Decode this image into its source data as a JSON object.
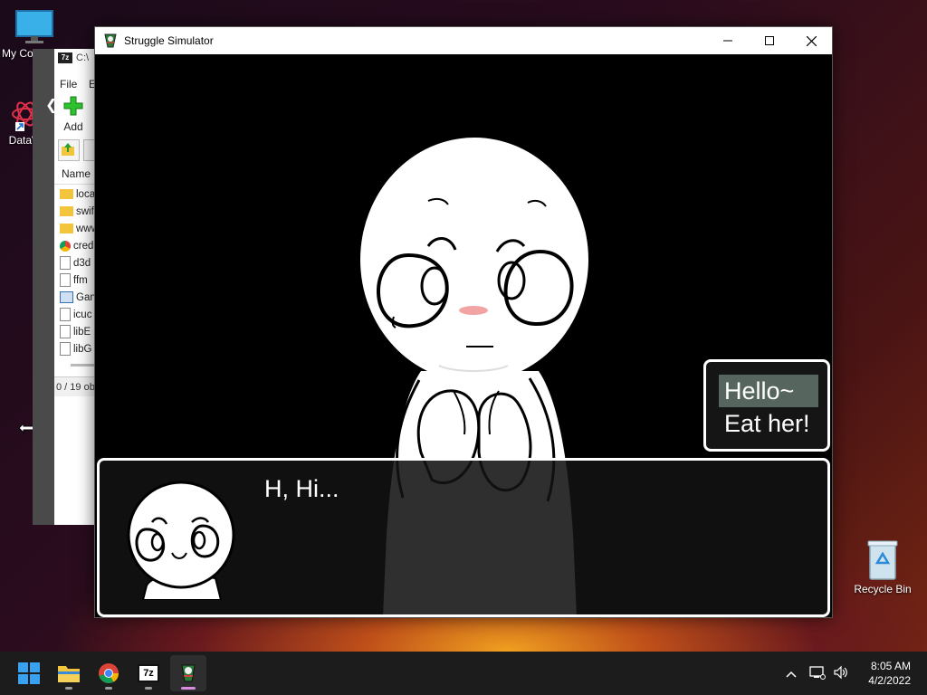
{
  "desktop": {
    "icons": [
      {
        "label": "My Co",
        "icon": "monitor-icon"
      },
      {
        "label": "DataW",
        "icon": "datawrangler-icon"
      },
      {
        "label": "Recycle Bin",
        "icon": "recycle-bin-icon"
      }
    ]
  },
  "zip_window": {
    "title": "C:\\",
    "menu": [
      "File",
      "E"
    ],
    "add_label": "Add",
    "column_name": "Name",
    "rows": [
      "loca",
      "swif",
      "www",
      "cred",
      "d3d",
      "ffm",
      "Gan",
      "icuc",
      "libE",
      "libG"
    ],
    "status": "0 / 19 ob"
  },
  "game_window": {
    "title": "Struggle Simulator",
    "choices": [
      {
        "label": "Hello~",
        "selected": true
      },
      {
        "label": "Eat her!",
        "selected": false
      }
    ],
    "dialog_text": "H, Hi..."
  },
  "taskbar": {
    "apps": [
      "start",
      "file-explorer",
      "chrome",
      "7zip",
      "struggle-simulator"
    ],
    "active_app": "struggle-simulator",
    "time": "8:05 AM",
    "date": "4/2/2022"
  },
  "colors": {
    "choice_highlight": "#56665f",
    "active_indicator": "#d98de0"
  }
}
